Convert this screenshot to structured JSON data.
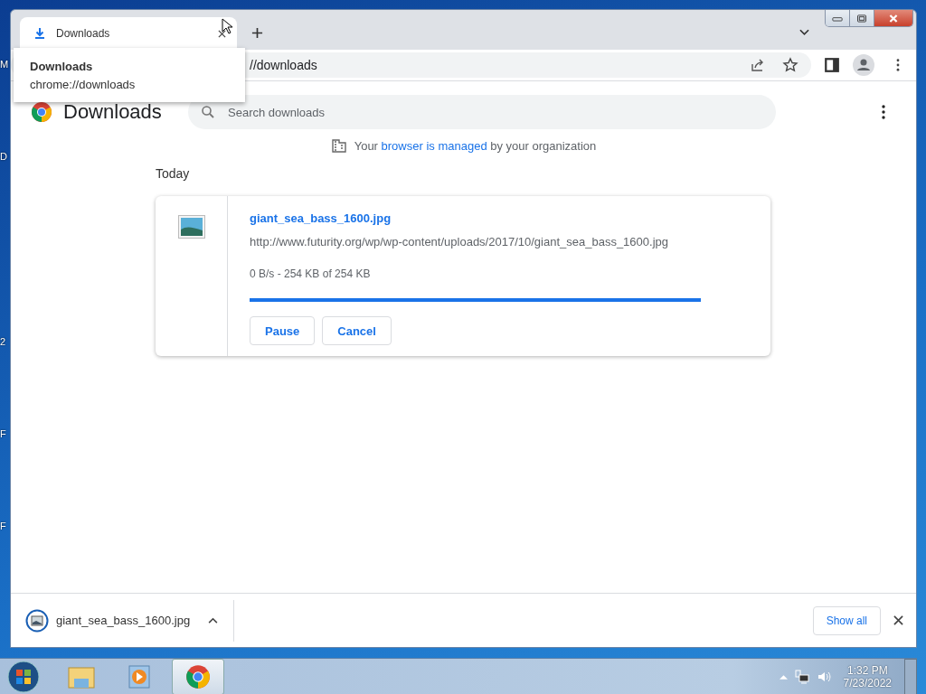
{
  "desktop_edge_labels": [
    "M",
    "D",
    "2",
    "F",
    "F"
  ],
  "tabs": [
    {
      "title": "Downloads",
      "selected": true
    }
  ],
  "tooltip": {
    "title": "Downloads",
    "url": "chrome://downloads"
  },
  "address_bar": {
    "value": "//downloads"
  },
  "page": {
    "title": "Downloads",
    "search": {
      "placeholder": "Search downloads"
    },
    "managed_notice": {
      "before": "Your",
      "link": "browser is managed",
      "after": "by your organization"
    },
    "section": "Today",
    "downloads": [
      {
        "file_name": "giant_sea_bass_1600.jpg",
        "url": "http://www.futurity.org/wp/wp-content/uploads/2017/10/giant_sea_bass_1600.jpg",
        "status": "0 B/s - 254 KB of 254 KB",
        "level": 1,
        "buttons": [
          "Pause",
          "Cancel"
        ]
      }
    ]
  },
  "download_shelf": {
    "items": [
      {
        "file_name": "giant_sea_bass_1600.jpg"
      }
    ],
    "show_all": "Show all"
  },
  "taskbar": {
    "apps": [
      {
        "kind": "explorer",
        "active": false
      },
      {
        "kind": "media",
        "active": false
      },
      {
        "kind": "chrome",
        "active": true
      }
    ],
    "time": "1:32 PM",
    "date": "7/23/2022"
  }
}
